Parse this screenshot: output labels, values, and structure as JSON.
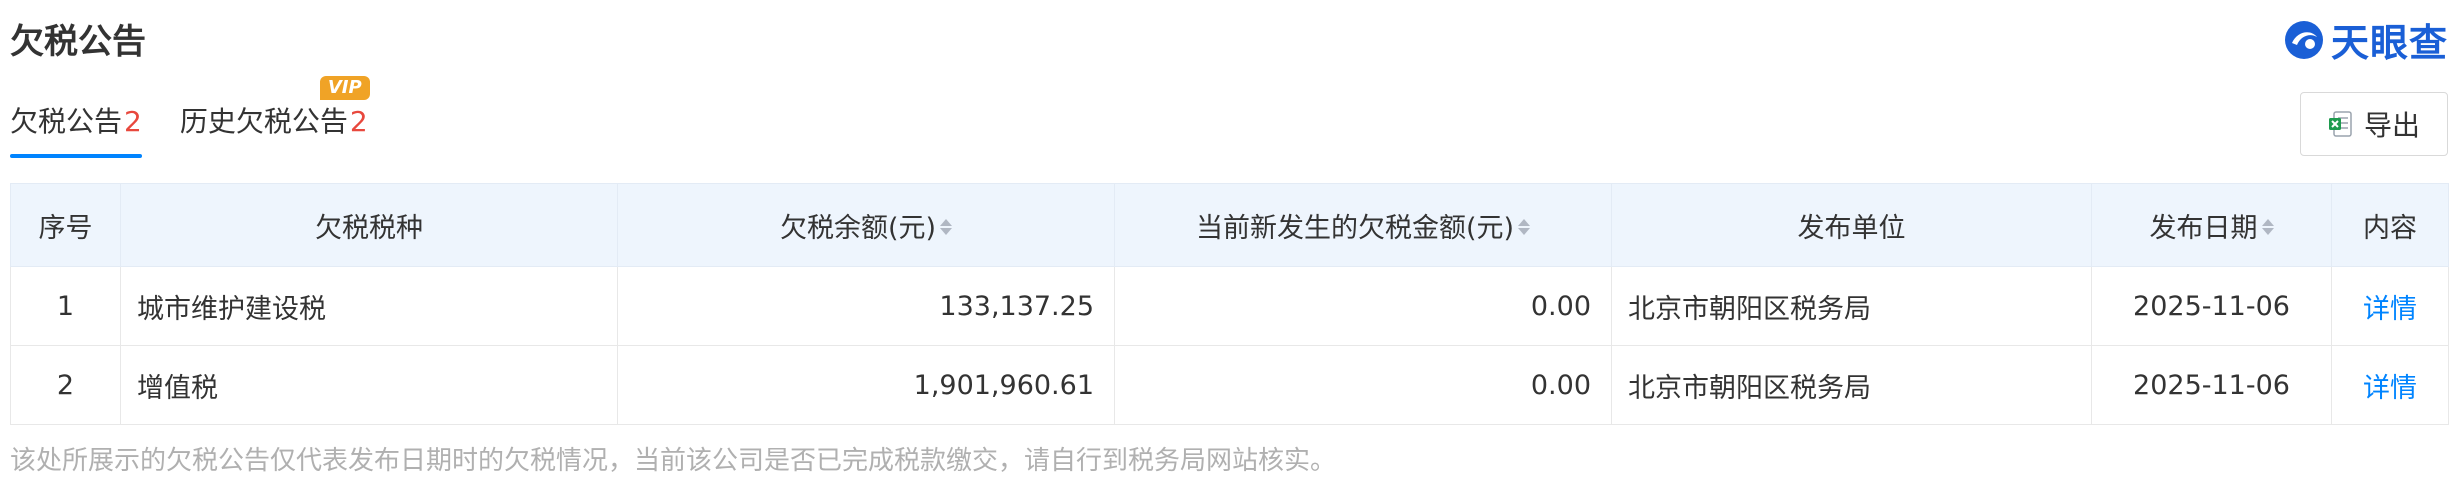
{
  "header": {
    "title": "欠税公告",
    "brand": "天眼查"
  },
  "tabs": [
    {
      "label": "欠税公告",
      "count": "2",
      "active": true
    },
    {
      "label": "历史欠税公告",
      "count": "2",
      "badge": "VIP",
      "active": false
    }
  ],
  "toolbar": {
    "export_label": "导出"
  },
  "table": {
    "columns": [
      "序号",
      "欠税税种",
      "欠税余额(元)",
      "当前新发生的欠税金额(元)",
      "发布单位",
      "发布日期",
      "内容"
    ],
    "rows": [
      {
        "index": "1",
        "tax_type": "城市维护建设税",
        "balance": "133,137.25",
        "new_amount": "0.00",
        "issuer": "北京市朝阳区税务局",
        "date": "2025-11-06",
        "action": "详情"
      },
      {
        "index": "2",
        "tax_type": "增值税",
        "balance": "1,901,960.61",
        "new_amount": "0.00",
        "issuer": "北京市朝阳区税务局",
        "date": "2025-11-06",
        "action": "详情"
      }
    ]
  },
  "footnote": "该处所展示的欠税公告仅代表发布日期时的欠税情况，当前该公司是否已完成税款缴交，请自行到税务局网站核实。",
  "colors": {
    "accent": "#0084ff",
    "count": "#e8483d",
    "vip": "#f0a326",
    "header_bg": "#eef5fd"
  }
}
